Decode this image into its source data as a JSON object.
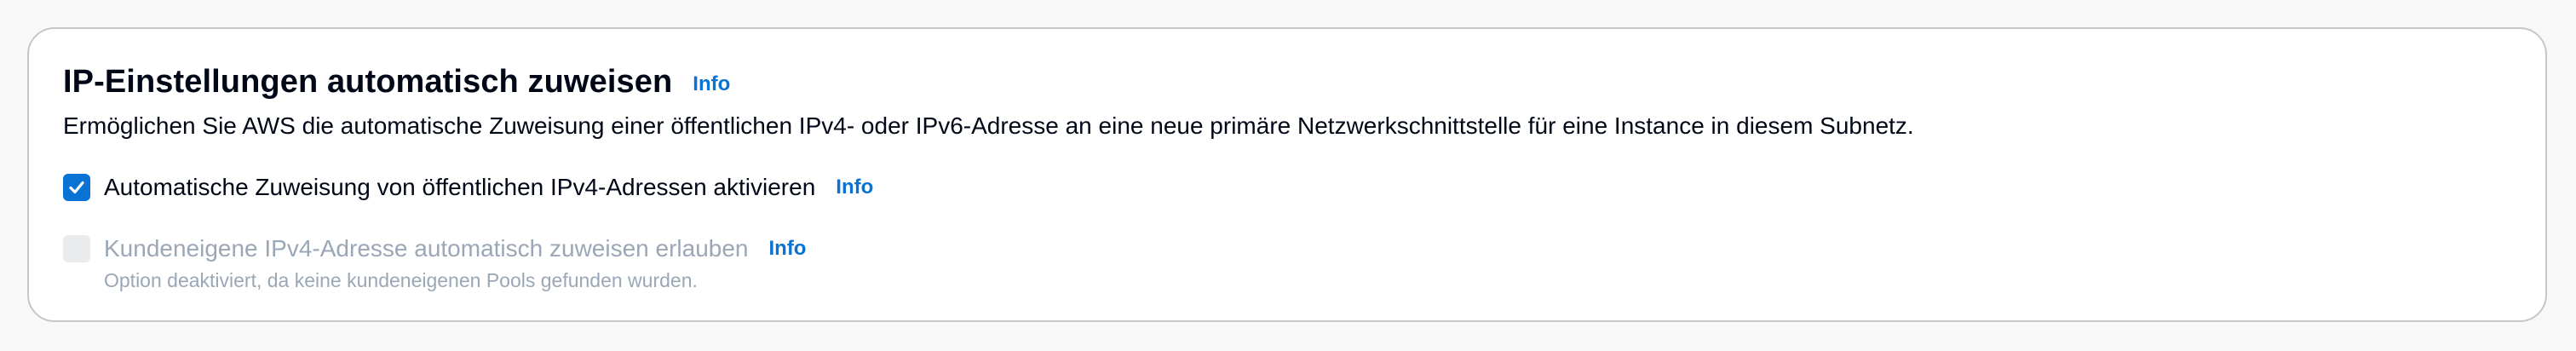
{
  "section": {
    "title": "IP-Einstellungen automatisch zuweisen",
    "info_label": "Info",
    "description": "Ermöglichen Sie AWS die automatische Zuweisung einer öffentlichen IPv4- oder IPv6-Adresse an eine neue primäre Netzwerkschnittstelle für eine Instance in diesem Subnetz."
  },
  "options": [
    {
      "label": "Automatische Zuweisung von öffentlichen IPv4-Adressen aktivieren",
      "info_label": "Info",
      "checked": true,
      "disabled": false
    },
    {
      "label": "Kundeneigene IPv4-Adresse automatisch zuweisen erlauben",
      "info_label": "Info",
      "checked": false,
      "disabled": true,
      "help_text": "Option deaktiviert, da keine kundeneigenen Pools gefunden wurden."
    }
  ],
  "colors": {
    "accent": "#0972d3",
    "disabled_text": "#9ba7b6",
    "border": "#c6c6cd"
  }
}
